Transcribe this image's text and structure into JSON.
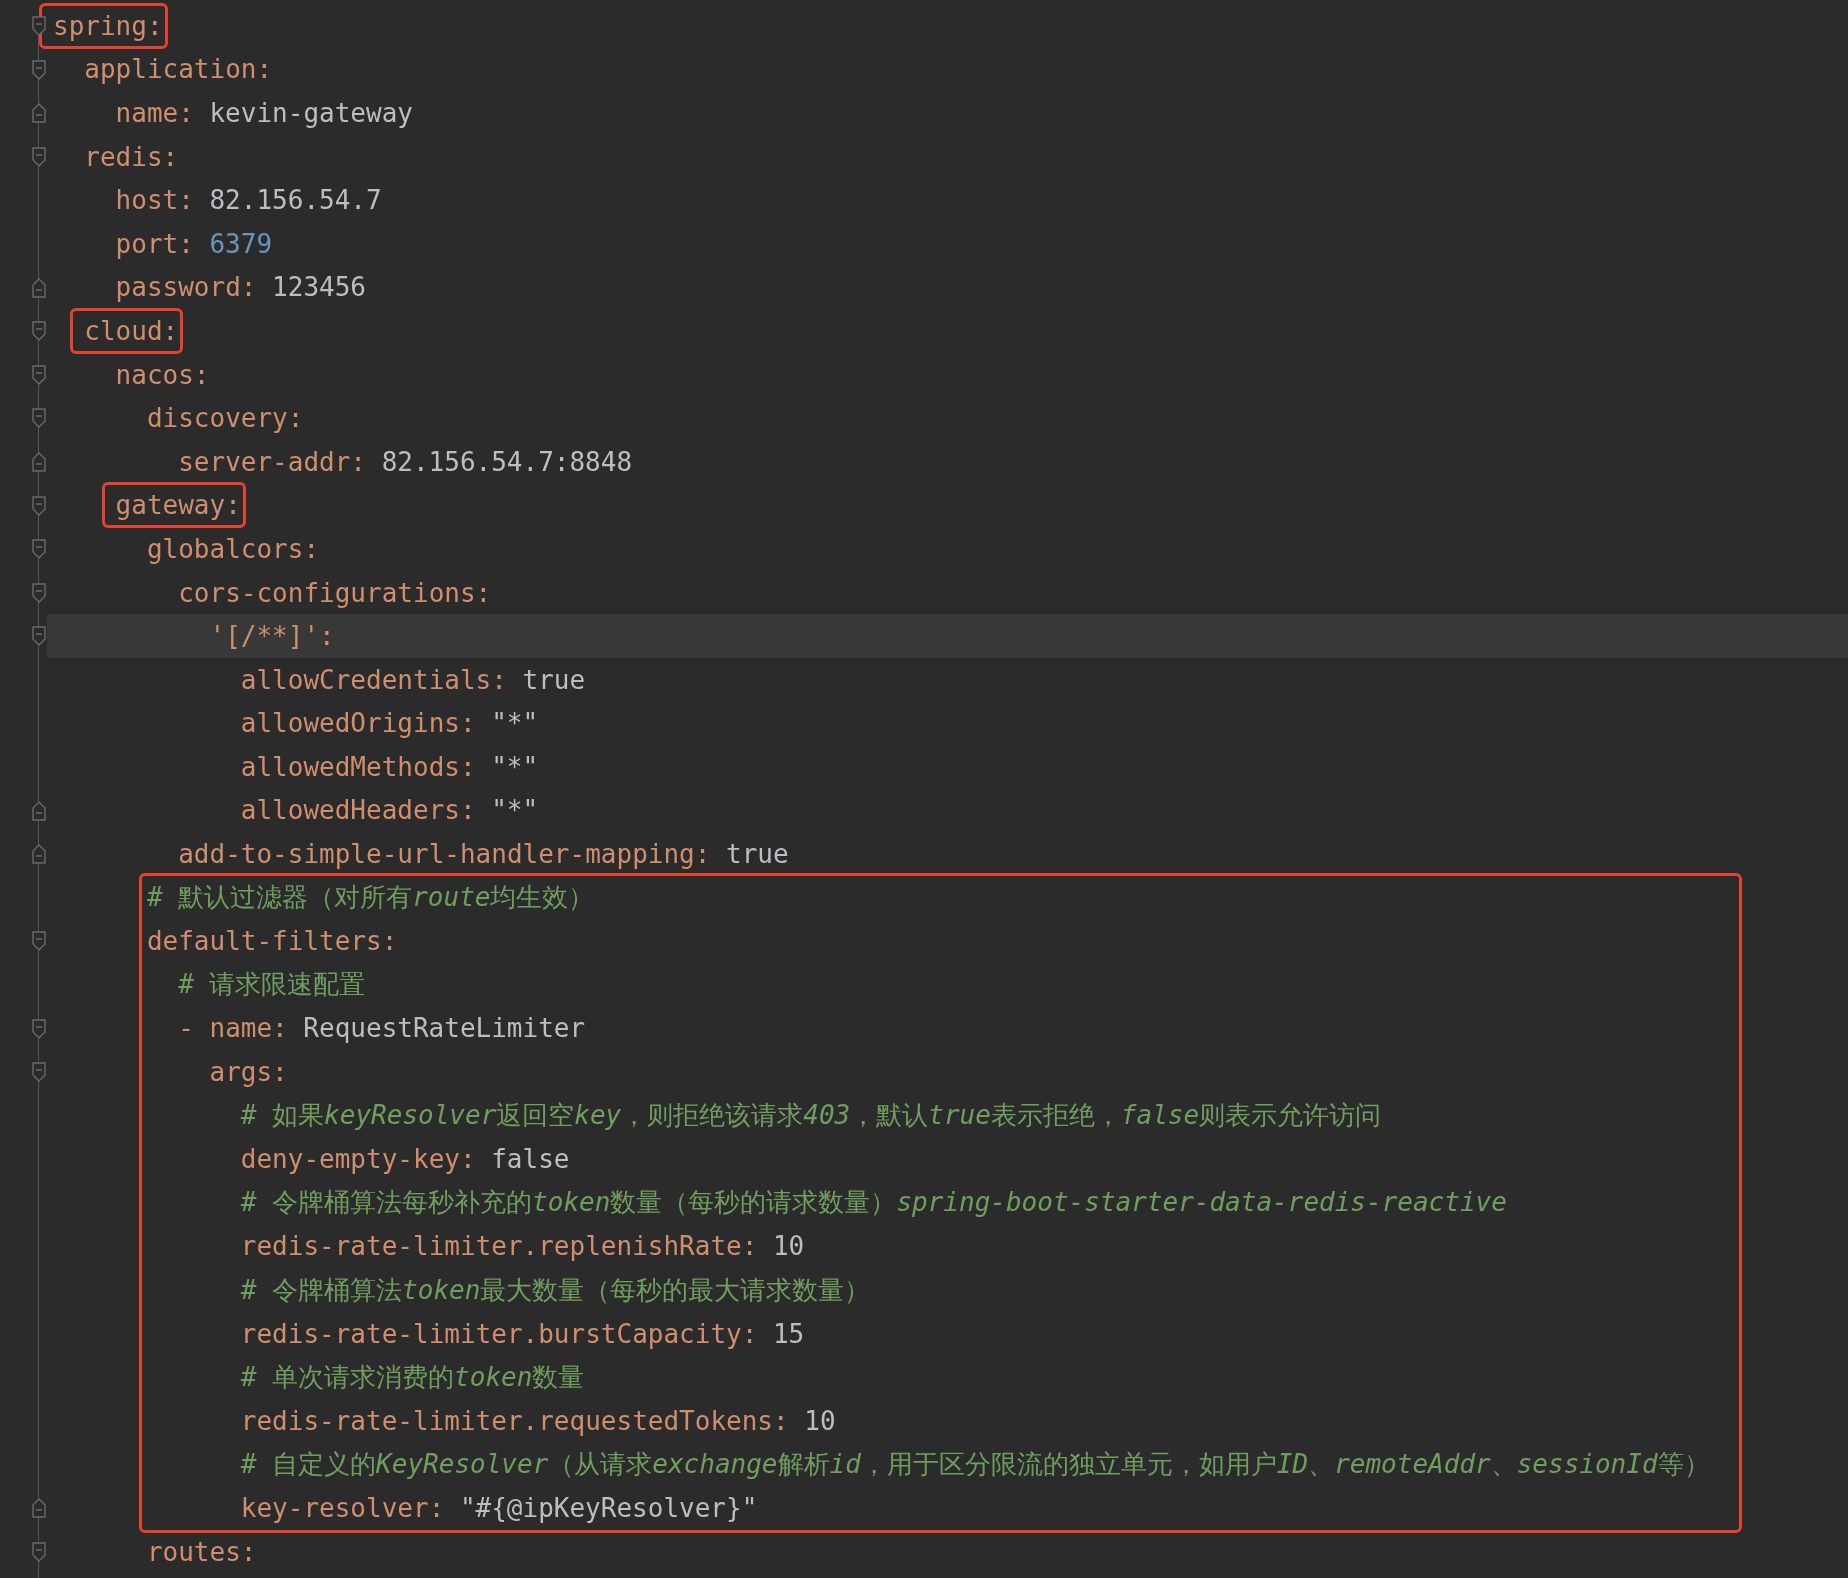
{
  "lines": [
    {
      "kind": "pair",
      "key": "spring:",
      "boxed": true,
      "current": false,
      "fold_start": true,
      "fold_end": false,
      "children": [
        {
          "kind": "pair",
          "key": "application:",
          "boxed": false,
          "current": false,
          "fold_start": true,
          "fold_end": false,
          "children": [
            {
              "kind": "pair",
              "key": "name:",
              "value": "kevin-gateway",
              "numeric_highlight": false,
              "boxed": false,
              "current": false,
              "fold_start": false,
              "fold_end": true
            }
          ]
        },
        {
          "kind": "pair",
          "key": "redis:",
          "boxed": false,
          "current": false,
          "fold_start": true,
          "fold_end": false,
          "children": [
            {
              "kind": "pair",
              "key": "host:",
              "value": "82.156.54.7",
              "numeric_highlight": false,
              "boxed": false,
              "current": false,
              "fold_start": false,
              "fold_end": false
            },
            {
              "kind": "pair",
              "key": "port:",
              "value": "6379",
              "numeric_highlight": true,
              "boxed": false,
              "current": false,
              "fold_start": false,
              "fold_end": false
            },
            {
              "kind": "pair",
              "key": "password:",
              "value": "123456",
              "numeric_highlight": false,
              "boxed": false,
              "current": false,
              "fold_start": false,
              "fold_end": true
            }
          ]
        },
        {
          "kind": "pair",
          "key": "cloud:",
          "boxed": true,
          "current": false,
          "fold_start": true,
          "fold_end": false,
          "children": [
            {
              "kind": "pair",
              "key": "nacos:",
              "boxed": false,
              "current": false,
              "fold_start": true,
              "fold_end": false,
              "children": [
                {
                  "kind": "pair",
                  "key": "discovery:",
                  "boxed": false,
                  "current": false,
                  "fold_start": true,
                  "fold_end": false,
                  "children": [
                    {
                      "kind": "pair",
                      "key": "server-addr:",
                      "value": "82.156.54.7:8848",
                      "numeric_highlight": false,
                      "boxed": false,
                      "current": false,
                      "fold_start": false,
                      "fold_end": true
                    }
                  ]
                }
              ]
            },
            {
              "kind": "pair",
              "key": "gateway:",
              "boxed": true,
              "current": false,
              "fold_start": true,
              "fold_end": false,
              "children": [
                {
                  "kind": "pair",
                  "key": "globalcors:",
                  "boxed": false,
                  "current": false,
                  "fold_start": true,
                  "fold_end": false,
                  "children": [
                    {
                      "kind": "pair",
                      "key": "cors-configurations:",
                      "boxed": false,
                      "current": false,
                      "fold_start": true,
                      "fold_end": false,
                      "children": [
                        {
                          "kind": "pair",
                          "key": "'[/**]':",
                          "boxed": false,
                          "current": true,
                          "fold_start": true,
                          "fold_end": false,
                          "children": [
                            {
                              "kind": "pair",
                              "key": "allowCredentials:",
                              "value": "true",
                              "numeric_highlight": false,
                              "boxed": false,
                              "current": false,
                              "fold_start": false,
                              "fold_end": false
                            },
                            {
                              "kind": "pair",
                              "key": "allowedOrigins:",
                              "value": "\"*\"",
                              "numeric_highlight": false,
                              "boxed": false,
                              "current": false,
                              "fold_start": false,
                              "fold_end": false
                            },
                            {
                              "kind": "pair",
                              "key": "allowedMethods:",
                              "value": "\"*\"",
                              "numeric_highlight": false,
                              "boxed": false,
                              "current": false,
                              "fold_start": false,
                              "fold_end": false
                            },
                            {
                              "kind": "pair",
                              "key": "allowedHeaders:",
                              "value": "\"*\"",
                              "numeric_highlight": false,
                              "boxed": false,
                              "current": false,
                              "fold_start": false,
                              "fold_end": true
                            }
                          ]
                        }
                      ]
                    },
                    {
                      "kind": "pair",
                      "key": "add-to-simple-url-handler-mapping:",
                      "value": "true",
                      "numeric_highlight": false,
                      "boxed": false,
                      "current": false,
                      "fold_start": false,
                      "fold_end": true
                    }
                  ]
                },
                {
                  "kind": "frame",
                  "children": [
                    {
                      "kind": "comment",
                      "current": false,
                      "parts": [
                        {
                          "text": "# 默认过滤器（对所有",
                          "italic": false
                        },
                        {
                          "text": "route",
                          "italic": true
                        },
                        {
                          "text": "均生效）",
                          "italic": false
                        }
                      ]
                    },
                    {
                      "kind": "pair",
                      "key": "default-filters:",
                      "boxed": false,
                      "current": false,
                      "fold_start": true,
                      "fold_end": false,
                      "children": [
                        {
                          "kind": "comment",
                          "current": false,
                          "parts": [
                            {
                              "text": "# 请求限速配置",
                              "italic": false
                            }
                          ]
                        },
                        {
                          "kind": "pair",
                          "key": "- name:",
                          "value": "RequestRateLimiter",
                          "numeric_highlight": false,
                          "boxed": false,
                          "current": false,
                          "fold_start": true,
                          "fold_end": false,
                          "children": [
                            {
                              "kind": "pair",
                              "key": "args:",
                              "boxed": false,
                              "current": false,
                              "fold_start": true,
                              "fold_end": false,
                              "children": [
                                {
                                  "kind": "comment",
                                  "current": false,
                                  "parts": [
                                    {
                                      "text": "# 如果",
                                      "italic": false
                                    },
                                    {
                                      "text": "keyResolver",
                                      "italic": true
                                    },
                                    {
                                      "text": "返回空",
                                      "italic": false
                                    },
                                    {
                                      "text": "key",
                                      "italic": true
                                    },
                                    {
                                      "text": "，则拒绝该请求",
                                      "italic": false
                                    },
                                    {
                                      "text": "403",
                                      "italic": true
                                    },
                                    {
                                      "text": "，默认",
                                      "italic": false
                                    },
                                    {
                                      "text": "true",
                                      "italic": true
                                    },
                                    {
                                      "text": "表示拒绝，",
                                      "italic": false
                                    },
                                    {
                                      "text": "false",
                                      "italic": true
                                    },
                                    {
                                      "text": "则表示允许访问",
                                      "italic": false
                                    }
                                  ]
                                },
                                {
                                  "kind": "pair",
                                  "key": "deny-empty-key:",
                                  "value": "false",
                                  "numeric_highlight": false,
                                  "boxed": false,
                                  "current": false,
                                  "fold_start": false,
                                  "fold_end": false
                                },
                                {
                                  "kind": "comment",
                                  "current": false,
                                  "parts": [
                                    {
                                      "text": "# 令牌桶算法每秒补充的",
                                      "italic": false
                                    },
                                    {
                                      "text": "token",
                                      "italic": true
                                    },
                                    {
                                      "text": "数量（每秒的请求数量）",
                                      "italic": false
                                    },
                                    {
                                      "text": "spring-boot-starter-data-redis-reactive",
                                      "italic": true
                                    }
                                  ]
                                },
                                {
                                  "kind": "pair",
                                  "key": "redis-rate-limiter.replenishRate:",
                                  "value": "10",
                                  "numeric_highlight": false,
                                  "boxed": false,
                                  "current": false,
                                  "fold_start": false,
                                  "fold_end": false
                                },
                                {
                                  "kind": "comment",
                                  "current": false,
                                  "parts": [
                                    {
                                      "text": "# 令牌桶算法",
                                      "italic": false
                                    },
                                    {
                                      "text": "token",
                                      "italic": true
                                    },
                                    {
                                      "text": "最大数量（每秒的最大请求数量）",
                                      "italic": false
                                    }
                                  ]
                                },
                                {
                                  "kind": "pair",
                                  "key": "redis-rate-limiter.burstCapacity:",
                                  "value": "15",
                                  "numeric_highlight": false,
                                  "boxed": false,
                                  "current": false,
                                  "fold_start": false,
                                  "fold_end": false
                                },
                                {
                                  "kind": "comment",
                                  "current": false,
                                  "parts": [
                                    {
                                      "text": "# 单次请求消费的",
                                      "italic": false
                                    },
                                    {
                                      "text": "token",
                                      "italic": true
                                    },
                                    {
                                      "text": "数量",
                                      "italic": false
                                    }
                                  ]
                                },
                                {
                                  "kind": "pair",
                                  "key": "redis-rate-limiter.requestedTokens:",
                                  "value": "10",
                                  "numeric_highlight": false,
                                  "boxed": false,
                                  "current": false,
                                  "fold_start": false,
                                  "fold_end": false
                                },
                                {
                                  "kind": "comment",
                                  "current": false,
                                  "parts": [
                                    {
                                      "text": "# 自定义的",
                                      "italic": false
                                    },
                                    {
                                      "text": "KeyResolver",
                                      "italic": true
                                    },
                                    {
                                      "text": "（从请求",
                                      "italic": false
                                    },
                                    {
                                      "text": "exchange",
                                      "italic": true
                                    },
                                    {
                                      "text": "解析",
                                      "italic": false
                                    },
                                    {
                                      "text": "id",
                                      "italic": true
                                    },
                                    {
                                      "text": "，用于区分限流的独立单元，如用户",
                                      "italic": false
                                    },
                                    {
                                      "text": "ID",
                                      "italic": true
                                    },
                                    {
                                      "text": "、",
                                      "italic": false
                                    },
                                    {
                                      "text": "remoteAddr",
                                      "italic": true
                                    },
                                    {
                                      "text": "、",
                                      "italic": false
                                    },
                                    {
                                      "text": "sessionId",
                                      "italic": true
                                    },
                                    {
                                      "text": "等）",
                                      "italic": false
                                    }
                                  ]
                                },
                                {
                                  "kind": "pair",
                                  "key": "key-resolver:",
                                  "value": "\"#{@ipKeyResolver}\"",
                                  "numeric_highlight": false,
                                  "boxed": false,
                                  "current": false,
                                  "fold_start": false,
                                  "fold_end": true
                                }
                              ]
                            }
                          ]
                        }
                      ]
                    }
                  ]
                },
                {
                  "kind": "pair",
                  "key": "routes:",
                  "boxed": false,
                  "current": false,
                  "fold_start": true,
                  "fold_end": false
                }
              ]
            }
          ]
        }
      ]
    }
  ]
}
